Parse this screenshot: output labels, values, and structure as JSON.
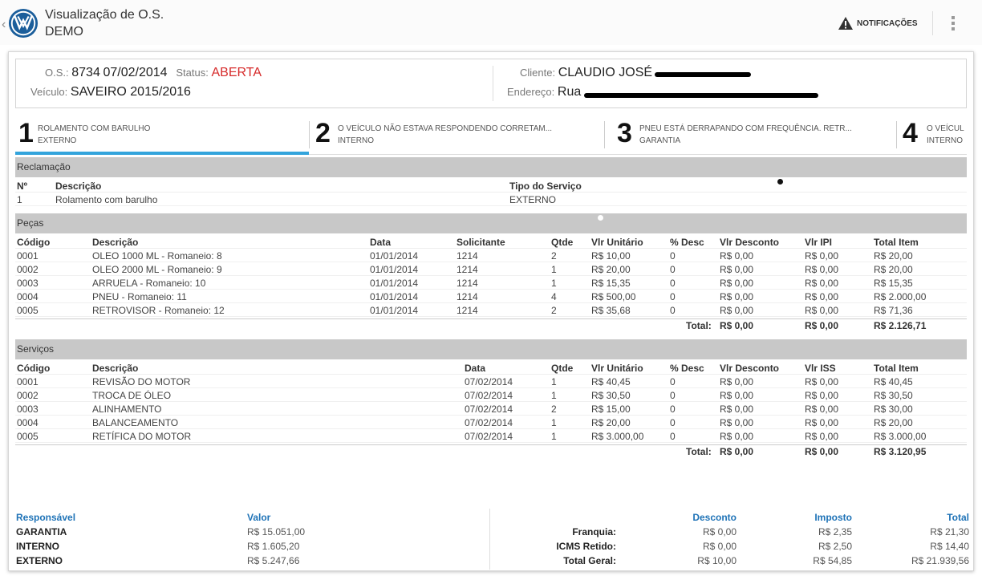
{
  "appbar": {
    "back_icon": "chevron-left-icon",
    "title": "Visualização de O.S.",
    "subtitle": "DEMO",
    "notifications_label": "NOTIFICAÇÕES"
  },
  "os": {
    "os_label": "O.S.:",
    "os_number": "8734",
    "os_date": "07/02/2014",
    "status_label": "Status:",
    "status_value": "ABERTA",
    "vehicle_label": "Veículo:",
    "vehicle_value": "SAVEIRO  2015/2016",
    "client_label": "Cliente:",
    "client_value": "CLAUDIO JOSÉ",
    "address_label": "Endereço:",
    "address_value": "Rua"
  },
  "steps": [
    {
      "num": "1",
      "line1": "ROLAMENTO COM BARULHO",
      "line2": "EXTERNO"
    },
    {
      "num": "2",
      "line1": "O VEÍCULO NÃO ESTAVA RESPONDENDO CORRETAM...",
      "line2": "INTERNO"
    },
    {
      "num": "3",
      "line1": "PNEU ESTÁ DERRAPANDO COM FREQUÊNCIA. RETR...",
      "line2": "GARANTIA"
    },
    {
      "num": "4",
      "line1": "O VEÍCUL",
      "line2": "INTERNO"
    }
  ],
  "reclamacao": {
    "title": "Reclamação",
    "headers": [
      "Nº",
      "Descrição",
      "Tipo do Serviço"
    ],
    "rows": [
      [
        "1",
        "Rolamento com barulho",
        "EXTERNO"
      ]
    ]
  },
  "pecas": {
    "title": "Peças",
    "headers": [
      "Código",
      "Descrição",
      "Data",
      "Solicitante",
      "Qtde",
      "Vlr Unitário",
      "% Desc",
      "Vlr Desconto",
      "Vlr IPI",
      "Total Item"
    ],
    "rows": [
      [
        "0001",
        "OLEO 1000 ML - Romaneio: 8",
        "01/01/2014",
        "1214",
        "2",
        "R$ 10,00",
        "0",
        "R$ 0,00",
        "R$ 0,00",
        "R$ 20,00"
      ],
      [
        "0002",
        "OLEO 2000 ML - Romaneio: 9",
        "01/01/2014",
        "1214",
        "1",
        "R$ 20,00",
        "0",
        "R$ 0,00",
        "R$ 0,00",
        "R$ 20,00"
      ],
      [
        "0003",
        "ARRUELA - Romaneio: 10",
        "01/01/2014",
        "1214",
        "1",
        "R$ 15,35",
        "0",
        "R$ 0,00",
        "R$ 0,00",
        "R$ 15,35"
      ],
      [
        "0004",
        "PNEU - Romaneio: 11",
        "01/01/2014",
        "1214",
        "4",
        "R$ 500,00",
        "0",
        "R$ 0,00",
        "R$ 0,00",
        "R$ 2.000,00"
      ],
      [
        "0005",
        "RETROVISOR - Romaneio: 12",
        "01/01/2014",
        "1214",
        "2",
        "R$ 35,68",
        "0",
        "R$ 0,00",
        "R$ 0,00",
        "R$ 71,36"
      ]
    ],
    "total_label": "Total:",
    "total_desconto": "R$ 0,00",
    "total_ipi": "R$ 0,00",
    "total_item": "R$ 2.126,71"
  },
  "servicos": {
    "title": "Serviços",
    "headers": [
      "Código",
      "Descrição",
      "Data",
      "Qtde",
      "Vlr Unitário",
      "% Desc",
      "Vlr Desconto",
      "Vlr ISS",
      "Total Item"
    ],
    "rows": [
      [
        "0001",
        "REVISÃO DO MOTOR",
        "07/02/2014",
        "1",
        "R$ 40,45",
        "0",
        "R$ 0,00",
        "R$ 0,00",
        "R$ 40,45"
      ],
      [
        "0002",
        "TROCA DE ÓLEO",
        "07/02/2014",
        "1",
        "R$ 30,50",
        "0",
        "R$ 0,00",
        "R$ 0,00",
        "R$ 30,50"
      ],
      [
        "0003",
        "ALINHAMENTO",
        "07/02/2014",
        "2",
        "R$ 15,00",
        "0",
        "R$ 0,00",
        "R$ 0,00",
        "R$ 30,00"
      ],
      [
        "0004",
        "BALANCEAMENTO",
        "07/02/2014",
        "1",
        "R$ 20,00",
        "0",
        "R$ 0,00",
        "R$ 0,00",
        "R$ 20,00"
      ],
      [
        "0005",
        "RETÍFICA DO MOTOR",
        "07/02/2014",
        "1",
        "R$ 3.000,00",
        "0",
        "R$ 0,00",
        "R$ 0,00",
        "R$ 3.000,00"
      ]
    ],
    "total_label": "Total:",
    "total_desconto": "R$ 0,00",
    "total_iss": "R$ 0,00",
    "total_item": "R$ 3.120,95"
  },
  "footer": {
    "responsavel_header": "Responsável",
    "valor_header": "Valor",
    "responsaveis": [
      {
        "name": "GARANTIA",
        "value": "R$ 15.051,00"
      },
      {
        "name": "INTERNO",
        "value": "R$ 1.605,20"
      },
      {
        "name": "EXTERNO",
        "value": "R$ 5.247,66"
      }
    ],
    "desconto_header": "Desconto",
    "imposto_header": "Imposto",
    "total_header": "Total",
    "totals": [
      {
        "label": "Franquia:",
        "desconto": "R$ 0,00",
        "imposto": "R$ 2,35",
        "total": "R$ 21,30"
      },
      {
        "label": "ICMS Retido:",
        "desconto": "R$ 0,00",
        "imposto": "R$ 2,50",
        "total": "R$ 14,40"
      },
      {
        "label": "Total Geral:",
        "desconto": "R$ 10,00",
        "imposto": "R$ 54,85",
        "total": "R$ 21.939,56"
      }
    ]
  },
  "colors": {
    "accent": "#33a4dc",
    "status_red": "#d62a2a",
    "footer_blue": "#1f73b7"
  }
}
